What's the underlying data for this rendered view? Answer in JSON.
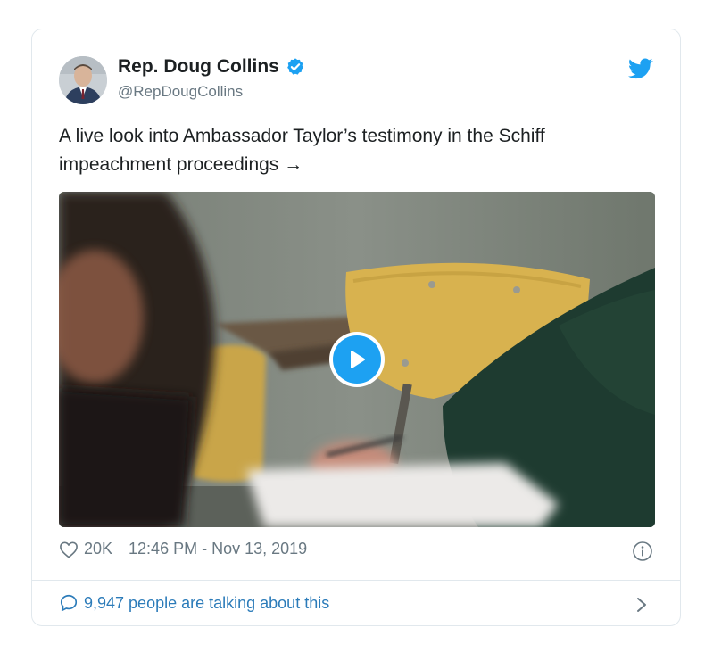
{
  "tweet": {
    "author_name": "Rep. Doug Collins",
    "author_handle": "@RepDougCollins",
    "text": "A live look into Ambassador Taylor’s testimony in the Schiff impeachment proceedings →",
    "likes": "20K",
    "timestamp": "12:46 PM - Nov 13, 2019",
    "talking": "9,947 people are talking about this"
  },
  "icons": {
    "verified": "verified-badge-icon",
    "brand": "twitter-bird-icon",
    "play": "play-icon",
    "like": "heart-icon",
    "info": "info-icon",
    "reply": "speech-bubble-icon",
    "chevron": "chevron-right-icon"
  },
  "colors": {
    "accent": "#1da1f2",
    "link": "#2b7bb9",
    "muted": "#697882",
    "border": "#e1e8ed"
  }
}
